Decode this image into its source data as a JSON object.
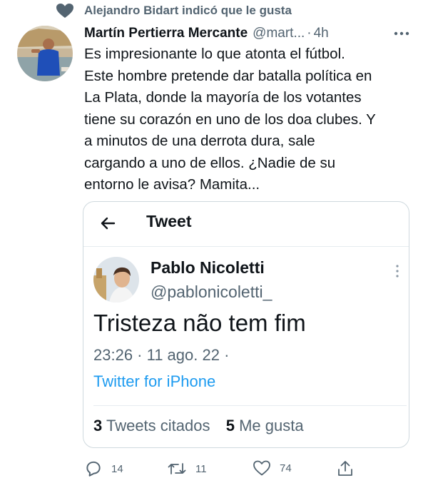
{
  "social_context": {
    "text": "Alejandro Bidart indicó que le gusta",
    "icon": "heart-icon"
  },
  "tweet": {
    "author_name": "Martín Pertierra Mercante",
    "author_handle": "@mart...",
    "separator": "·",
    "time_ago": "4h",
    "text": "Es impresionante lo que atonta el fútbol.\nEste hombre pretende dar batalla política en\nLa Plata, donde la mayoría de los votantes\ntiene su corazón en uno de los doa clubes. Y\na minutos de una derrota dura, sale\ncargando a uno de ellos. ¿Nadie de su\nentorno le avisa? Mamita..."
  },
  "quoted_screenshot": {
    "screen_title": "Tweet",
    "author_name": "Pablo Nicoletti",
    "author_handle": "@pablonicoletti_",
    "text": "Tristeza não tem fim",
    "timestamp": "23:26 · 11 ago. 22 ·",
    "source": "Twitter for iPhone",
    "stats": {
      "quotes_count": "3",
      "quotes_label": "Tweets citados",
      "likes_count": "5",
      "likes_label": "Me gusta"
    }
  },
  "actions": {
    "reply_count": "14",
    "retweet_count": "11",
    "like_count": "74"
  },
  "colors": {
    "text_primary": "#0f1419",
    "text_secondary": "#536471",
    "link_blue": "#1d9bf0",
    "border": "#cfd9de"
  }
}
